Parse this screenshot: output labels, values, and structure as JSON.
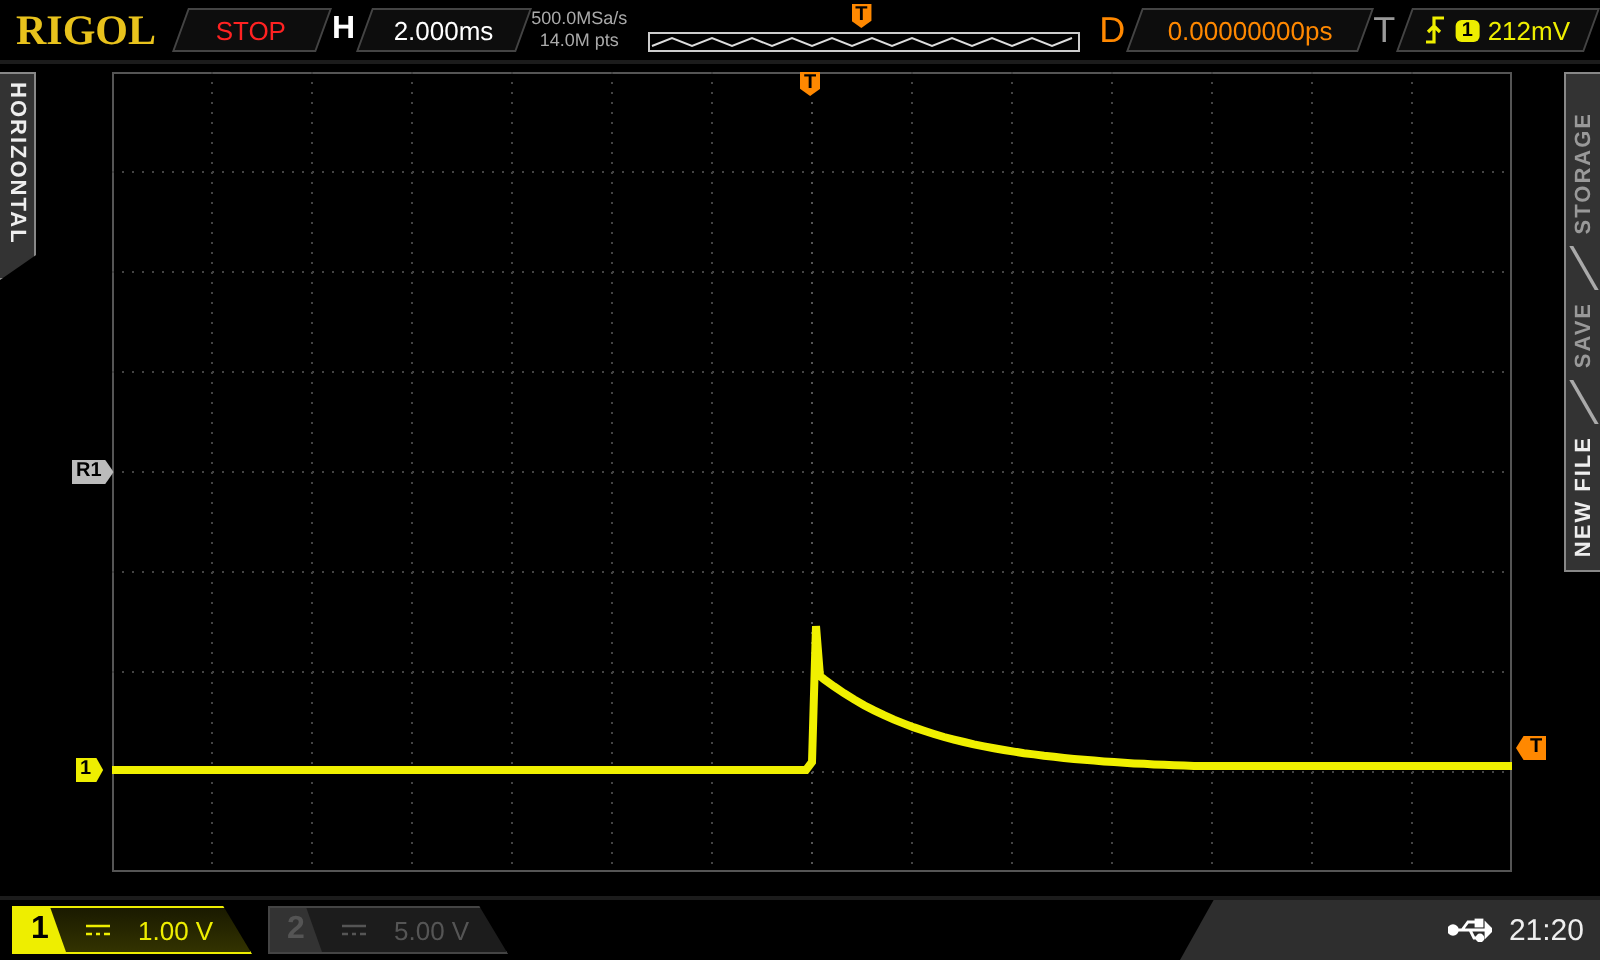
{
  "brand": "RIGOL",
  "run_state": "STOP",
  "horizontal": {
    "label": "H",
    "timebase": "2.000ms",
    "sample_rate": "500.0MSa/s",
    "memory_depth": "14.0M pts"
  },
  "memory_marker": "T",
  "delay": {
    "label": "D",
    "value": "0.00000000ps"
  },
  "trigger": {
    "label": "T",
    "source": "1",
    "level": "212mV"
  },
  "side_tabs": {
    "left": "HORIZONTAL",
    "right": [
      {
        "label": "NEW FILE"
      },
      {
        "label": "SAVE"
      },
      {
        "label": "STORAGE"
      }
    ]
  },
  "markers": {
    "trigger_position": "T",
    "reference": "R1",
    "channel": "1",
    "trigger_level": "T"
  },
  "channels": [
    {
      "number": "1",
      "scale": "1.00 V",
      "enabled": true
    },
    {
      "number": "2",
      "scale": "5.00 V",
      "enabled": false
    }
  ],
  "status": {
    "time": "21:20"
  }
}
